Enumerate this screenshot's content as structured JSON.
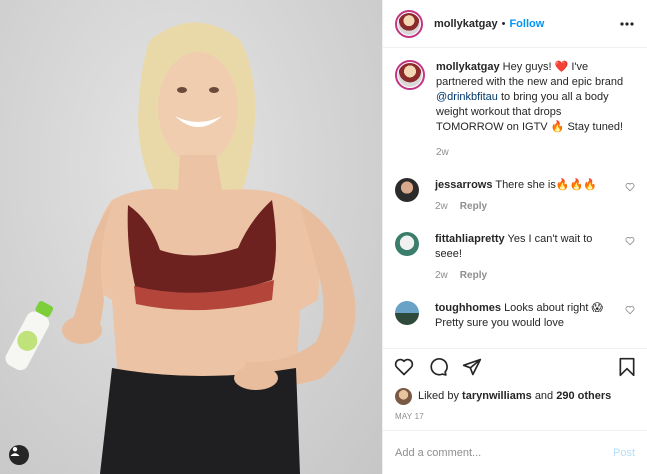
{
  "post": {
    "username": "mollykatgay",
    "follow_label": "Follow",
    "separator": "•"
  },
  "caption": {
    "username": "mollykatgay",
    "text_1": "Hey guys! ❤️ I've partnered with the new and epic brand ",
    "mention": "@drinkbfitau",
    "text_2": " to bring you all a body weight workout that drops TOMORROW on IGTV 🔥 Stay tuned!",
    "age": "2w"
  },
  "comments": [
    {
      "username": "jessarrows",
      "text": "There she is🔥🔥🔥",
      "age": "2w",
      "reply_label": "Reply"
    },
    {
      "username": "fittahliapretty",
      "text": "Yes I can't wait to seee!",
      "age": "2w",
      "reply_label": "Reply"
    },
    {
      "username": "toughhomes",
      "text": "Looks about right 😱 Pretty sure you would love",
      "age": "",
      "reply_label": ""
    }
  ],
  "likes": {
    "prefix": "Liked by ",
    "user": "tarynwilliams",
    "middle": " and ",
    "others": "290 others"
  },
  "date": "MAY 17",
  "add_comment": {
    "placeholder": "Add a comment...",
    "post_label": "Post"
  },
  "icons": {
    "more": "more-horizontal-icon",
    "like": "heart-icon",
    "comment": "comment-bubble-icon",
    "share": "paper-plane-icon",
    "save": "bookmark-icon",
    "tag": "user-tag-icon"
  },
  "colors": {
    "follow": "#0095f6",
    "mention": "#00376b",
    "muted": "#8e8e8e",
    "post_disabled": "#b2dffc"
  }
}
